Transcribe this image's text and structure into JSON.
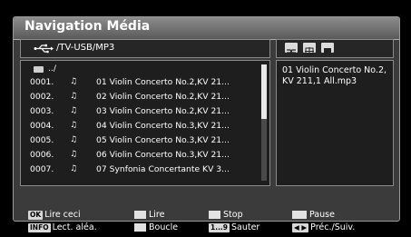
{
  "header": {
    "title": "Navigation Média"
  },
  "path": {
    "text": "/TV-USB/MP3"
  },
  "list": {
    "parent_label": "../",
    "rows": [
      {
        "index": "0001.",
        "name": "01 Violin Concerto No.2,KV 21..."
      },
      {
        "index": "0002.",
        "name": "02 Violin Concerto No.2,KV 21..."
      },
      {
        "index": "0003.",
        "name": "03 Violin Concerto No.2,KV 21..."
      },
      {
        "index": "0004.",
        "name": "04 Violin Concerto No.3,KV 21..."
      },
      {
        "index": "0005.",
        "name": "05 Violin Concerto No.3,KV 21..."
      },
      {
        "index": "0006.",
        "name": "06 Violin Concerto No.3,KV 21..."
      },
      {
        "index": "0007.",
        "name": "07 Synfonia Concertante KV 3..."
      }
    ]
  },
  "info": {
    "filename": "01 Violin Concerto No.2,KV 211,1 All.mp3"
  },
  "footer": {
    "ok_key": "OK",
    "ok_label": "Lire ceci",
    "info_key": "INFO",
    "info_label": "Lect. aléa.",
    "play_label": "Lire",
    "loop_label": "Boucle",
    "stop_label": "Stop",
    "jump_key": "1...9",
    "jump_label": "Sauter",
    "pause_label": "Pause",
    "prevnext_label": "Préc./Suiv."
  },
  "colors": {
    "panel": "#3b3b3b",
    "header": "#7a7a7a",
    "list_bg": "#1e1e1e"
  }
}
